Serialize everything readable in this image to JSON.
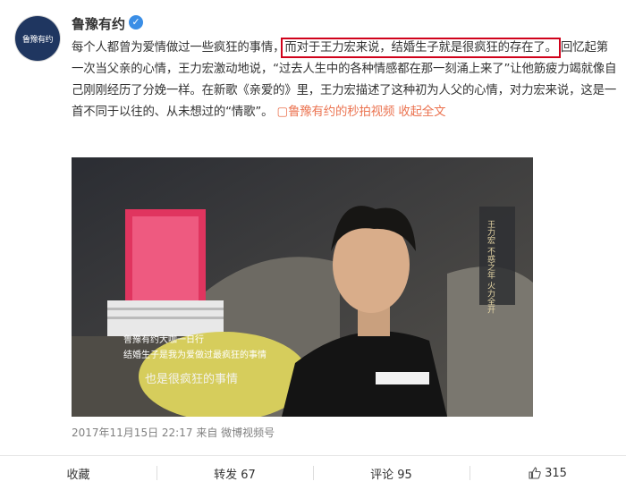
{
  "post": {
    "author": "鲁豫有约",
    "avatar_text": "鲁豫有约",
    "text_before": "每个人都曾为爱情做过一些疯狂的事情，",
    "text_highlight": "而对于王力宏来说，结婚生子就是很疯狂的存在了。",
    "text_after": "回忆起第一次当父亲的心情，王力宏激动地说，“过去人生中的各种情感都在那一刻涌上来了”让他筋疲力竭就像自己刚刚经历了分娩一样。在新歌《亲爱的》里，王力宏描述了这种初为人父的心情，对力宏来说，这是一首不同于以往的、从未想过的“情歌”。",
    "link_text": "鲁豫有约的秒拍视频",
    "expand_text": "收起全文",
    "expand_suffix": "",
    "timestamp": "2017年11月15日 22:17",
    "source_prefix": "来自",
    "source": "微博视频号"
  },
  "media": {
    "side_caption": "王力宏 不惑之年 火力全开",
    "caption_line1": "鲁豫有约大咖一日行",
    "caption_line2": "结婚生子是我为爱做过最疯狂的事情",
    "subtitle": "也是很疯狂的事情"
  },
  "actions": {
    "favorite": "收藏",
    "repost": "转发 67",
    "comment": "评论 95",
    "like": "315"
  },
  "colors": {
    "highlight_box": "#d0021b",
    "link": "#eb7350",
    "verified": "#3a8ee6"
  }
}
